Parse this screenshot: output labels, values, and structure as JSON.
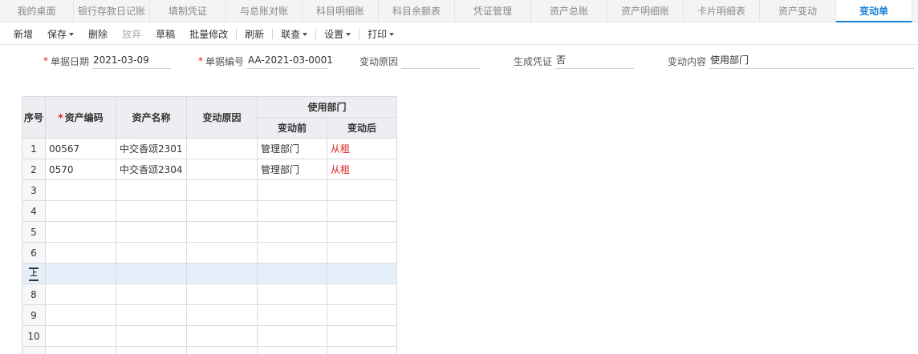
{
  "tabs": [
    {
      "label": "我的桌面"
    },
    {
      "label": "银行存款日记账"
    },
    {
      "label": "填制凭证"
    },
    {
      "label": "与总账对账"
    },
    {
      "label": "科目明细账"
    },
    {
      "label": "科目余额表"
    },
    {
      "label": "凭证管理"
    },
    {
      "label": "资产总账"
    },
    {
      "label": "资产明细账"
    },
    {
      "label": "卡片明细表"
    },
    {
      "label": "资产变动"
    },
    {
      "label": "变动单"
    }
  ],
  "active_tab": "变动单",
  "toolbar": {
    "new": "新增",
    "save": "保存",
    "delete": "删除",
    "abandon": "放弃",
    "draft": "草稿",
    "batch_edit": "批量修改",
    "refresh": "刷新",
    "lookup": "联查",
    "settings": "设置",
    "print": "打印"
  },
  "form": {
    "doc_date_label": "单据日期",
    "doc_date_value": "2021-03-09",
    "doc_no_label": "单据编号",
    "doc_no_value": "AA-2021-03-0001",
    "reason_label": "变动原因",
    "reason_value": "",
    "voucher_label": "生成凭证",
    "voucher_value": "否",
    "content_label": "变动内容",
    "content_value": "使用部门"
  },
  "table": {
    "headers": {
      "seq": "序号",
      "asset_code": "资产编码",
      "asset_name": "资产名称",
      "change_reason": "变动原因",
      "dept_group": "使用部门",
      "before": "变动前",
      "after": "变动后"
    },
    "rows": [
      {
        "seq": "1",
        "code": "00567",
        "name": "中交香颂2301",
        "reason": "",
        "before": "管理部门",
        "after": "从租"
      },
      {
        "seq": "2",
        "code": "0570",
        "name": "中交香颂2304",
        "reason": "",
        "before": "管理部门",
        "after": "从租"
      },
      {
        "seq": "3",
        "code": "",
        "name": "",
        "reason": "",
        "before": "",
        "after": ""
      },
      {
        "seq": "4",
        "code": "",
        "name": "",
        "reason": "",
        "before": "",
        "after": ""
      },
      {
        "seq": "5",
        "code": "",
        "name": "",
        "reason": "",
        "before": "",
        "after": ""
      },
      {
        "seq": "6",
        "code": "",
        "name": "",
        "reason": "",
        "before": "",
        "after": ""
      },
      {
        "seq": "",
        "code": "",
        "name": "",
        "reason": "",
        "before": "",
        "after": ""
      },
      {
        "seq": "8",
        "code": "",
        "name": "",
        "reason": "",
        "before": "",
        "after": ""
      },
      {
        "seq": "9",
        "code": "",
        "name": "",
        "reason": "",
        "before": "",
        "after": ""
      },
      {
        "seq": "10",
        "code": "",
        "name": "",
        "reason": "",
        "before": "",
        "after": ""
      },
      {
        "seq": "",
        "code": "",
        "name": "",
        "reason": "",
        "before": "",
        "after": ""
      }
    ],
    "selected_row_index": 6
  }
}
